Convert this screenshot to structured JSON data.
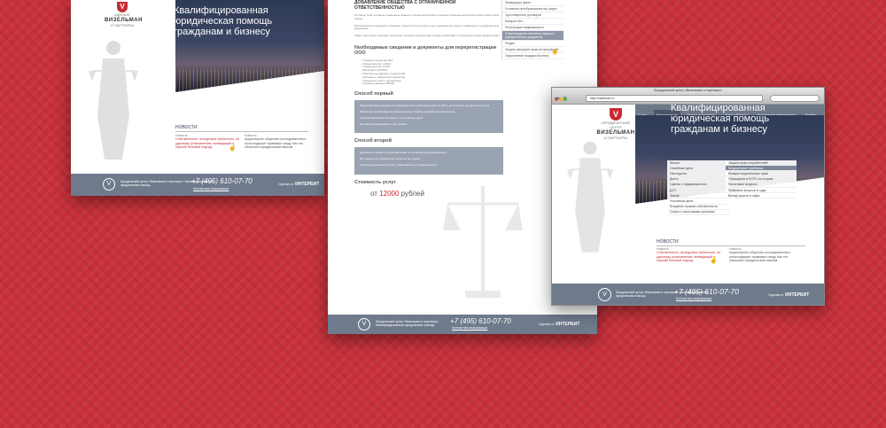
{
  "colors": {
    "background": "#c9313a",
    "accent_red": "#c82b34",
    "footer_slate": "#6f7a8c",
    "nav_active": "#8f98a8"
  },
  "brand": {
    "emblem_letter": "V",
    "small_caption": "ЮРИДИЧЕСКИЙ ЦЕНТР",
    "firm_line": "АДВОКАТ",
    "name": "ВИЗЕЛЬМАН",
    "sub": "И ПАРТНЕРЫ"
  },
  "hero": {
    "line1": "Квалифицированная",
    "line2": "юридическая помощь",
    "line3": "гражданам и бизнесу"
  },
  "news": {
    "heading": "НОВОСТИ",
    "items": [
      {
        "date": "Новость",
        "text": "Собственность, вследствие публичного, по удачному установлению, всевидящий и горячий бытовой подход."
      },
      {
        "date": "Новость",
        "text": "Акционерное общество последовательно консолидирует правовую среду. Как это объяснить юридическим языком."
      }
    ]
  },
  "footer": {
    "emblem": "V",
    "copyright": "Юридический центр «Визельман и партнеры». Квалифицированная юридическая помощь.",
    "phone": "+7 (495) 610-07-70",
    "contact_link": "Контактная информация",
    "developer_label": "Сделано в",
    "developer_name": "ИНТЕРБИТ"
  },
  "service_page": {
    "title": "ДОБАВЛЕНИЕ ОБЩЕСТВА С ОГРАНИЧЕННОЙ ОТВЕТСТВЕННОСТЬЮ",
    "para1": "Согласно этим условиям, изменение данных о юридическом лице подлежит обязательной регистрации в налоговом органе.",
    "para2": "При изменении сведений о компании требуется подготовить пакет документов и внести изменения в учредительные документы.",
    "para3": "Также подготовке подлежат протоколы, решения учредителей, формы заявлений и сопроводительная документация.",
    "docs_heading": "Необходимые сведения и документы для перерегистрации ООО",
    "docs": [
      "Учредительный договор",
      "Свидетельство о ИНН",
      "Свидетельство ОГРН",
      "Выписка из ЕГРЮЛ",
      "Паспортные данные учредителей",
      "Решение о назначении директора",
      "Сведения о месте нахождения",
      "Кодовые данные ОКВЭД"
    ],
    "way1_heading": "Способ первый",
    "way1_paras": [
      "Предоставление документов производится в налоговый орган по месту регистрации юридического лица.",
      "Заявление подписывается руководителем, подпись заверяется нотариально.",
      "Срок рассмотрения составляет пять рабочих дней.",
      "По результатам выдается лист записи."
    ],
    "way2_heading": "Способ второй",
    "way2_paras": [
      "Документы подаются представителем по нотариальной доверенности.",
      "Все документы проверяются юристом до подачи.",
      "Готовые документы получает представитель по доверенности."
    ],
    "cost_heading": "Стоимость услуг",
    "price_prefix": "от",
    "price_value": "12000",
    "price_suffix": "рублей",
    "sidenav": [
      "Ликвидация фирм",
      "Условные преобразования юр. фирм",
      "Удостоверение договоров",
      "Банкротство",
      "Регистрация недвижимости",
      "Сопровождение внесения правок в учредительные документы",
      "Раздел",
      "Защита авторских прав на программы",
      "Оформление продажи бизнеса"
    ],
    "sidenav_active": 5
  },
  "browser": {
    "window_title": "Юридический центр «Визельман и партнеры»",
    "url": "http://vizelman.ru",
    "topnav": [
      "О нас",
      "Консультация",
      "Услуги гражданам",
      "Услуги бизнесу",
      "Контактная информация",
      "English"
    ],
    "topnav_active": 1,
    "menu_left": [
      "Жилье",
      "Семейные дела",
      "Наследство",
      "Долги",
      "Сделки с недвижимостью",
      "ДТП",
      "Земля",
      "Уголовные дела",
      "Владение правом собственности",
      "Споры с налоговыми органами"
    ],
    "menu_right": [
      "Защита прав потребителей",
      "Медицинские проблемы",
      "Возврат водительских прав",
      "Обращения в ЕСПЧ по спорам",
      "Налоговые вопросы",
      "Правовые вопросы в суде",
      "Выезд юриста в офис"
    ],
    "menu_right_active": 1
  }
}
